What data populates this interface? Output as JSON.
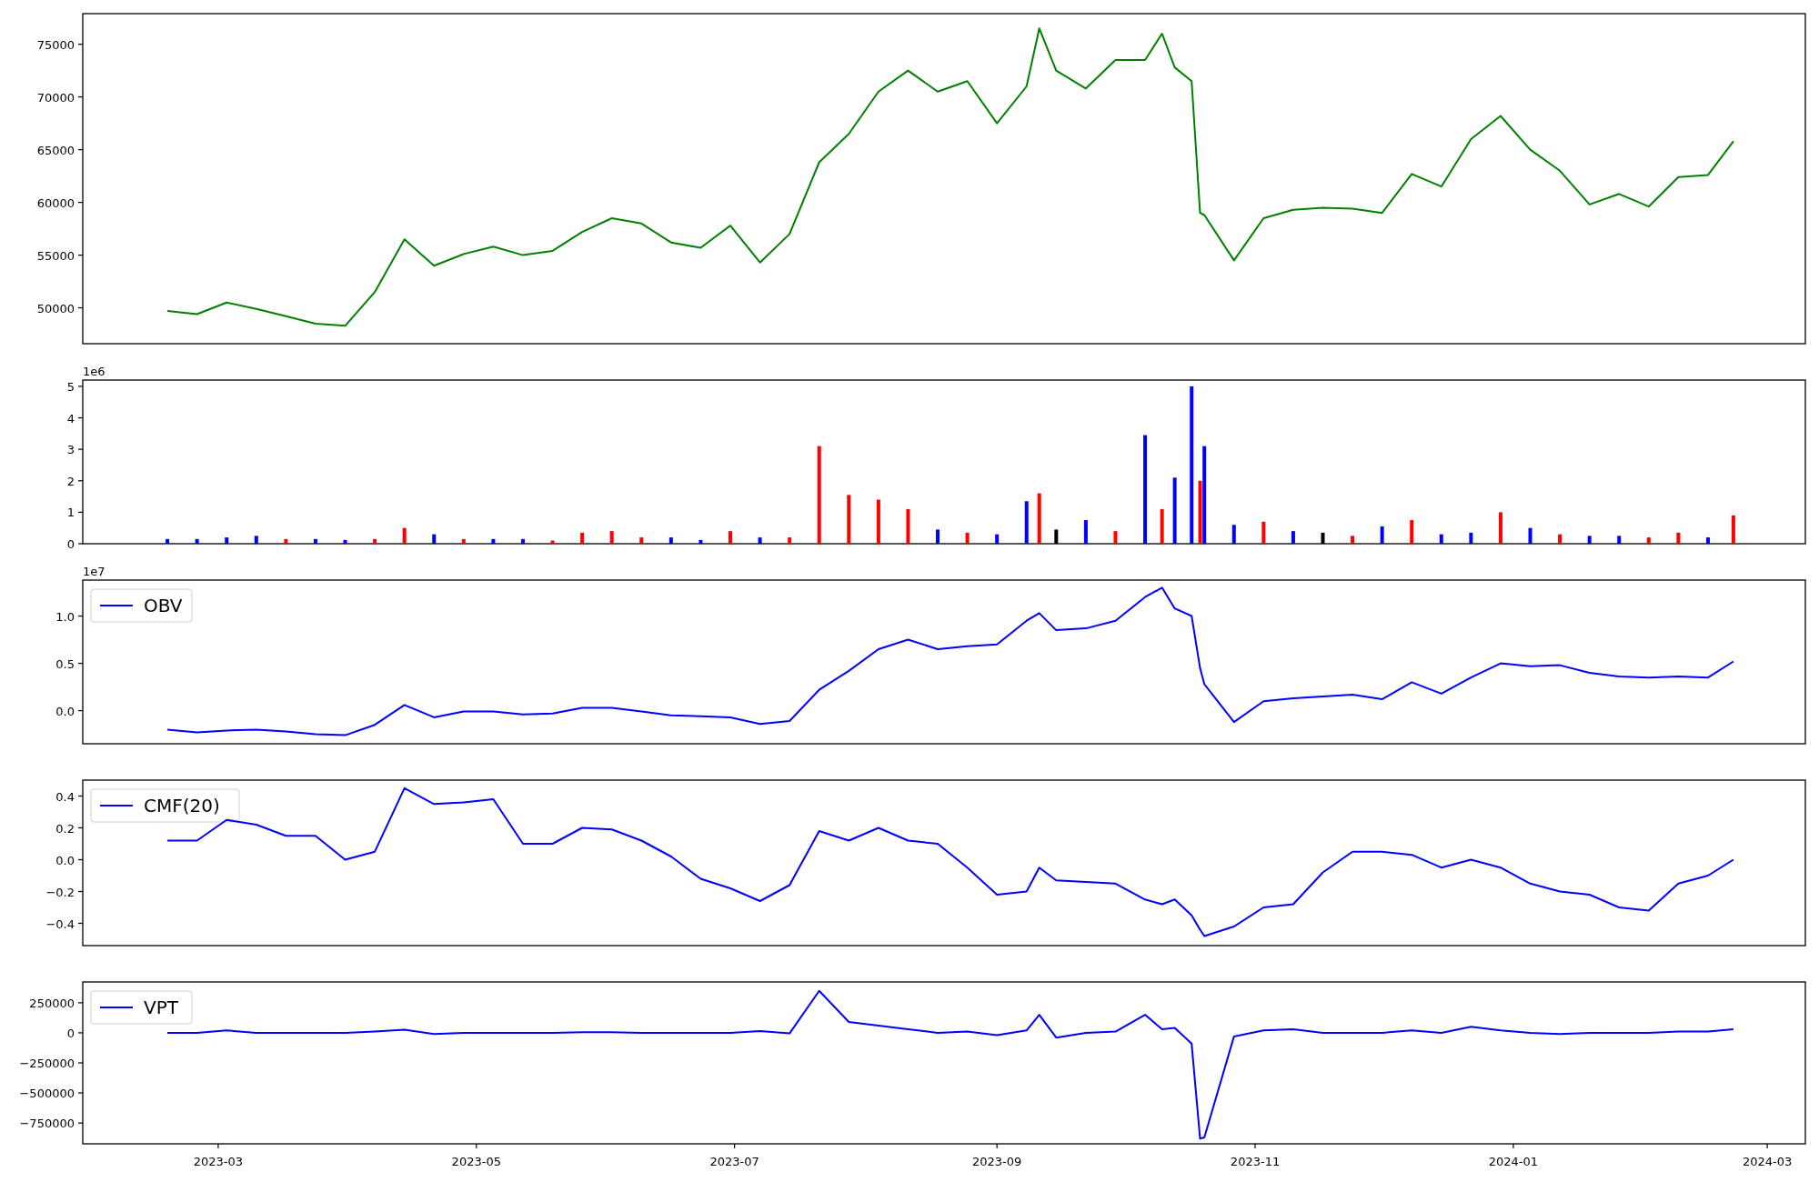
{
  "panels": [
    {
      "chart_data": {
        "type": "line",
        "x": [
          "2023-02-17",
          "2023-02-24",
          "2023-03-03",
          "2023-03-10",
          "2023-03-17",
          "2023-03-24",
          "2023-03-31",
          "2023-04-07",
          "2023-04-14",
          "2023-04-21",
          "2023-04-28",
          "2023-05-05",
          "2023-05-12",
          "2023-05-19",
          "2023-05-26",
          "2023-06-02",
          "2023-06-09",
          "2023-06-16",
          "2023-06-23",
          "2023-06-30",
          "2023-07-07",
          "2023-07-14",
          "2023-07-21",
          "2023-07-28",
          "2023-08-04",
          "2023-08-11",
          "2023-08-18",
          "2023-08-25",
          "2023-09-01",
          "2023-09-08",
          "2023-09-11",
          "2023-09-15",
          "2023-09-22",
          "2023-09-29",
          "2023-10-06",
          "2023-10-10",
          "2023-10-13",
          "2023-10-17",
          "2023-10-19",
          "2023-10-20",
          "2023-10-27",
          "2023-11-03",
          "2023-11-10",
          "2023-11-17",
          "2023-11-24",
          "2023-12-01",
          "2023-12-08",
          "2023-12-15",
          "2023-12-22",
          "2023-12-29",
          "2024-01-05",
          "2024-01-12",
          "2024-01-19",
          "2024-01-26",
          "2024-02-02",
          "2024-02-09",
          "2024-02-16",
          "2024-02-22"
        ],
        "series": [
          {
            "color": "#008000",
            "values": [
              49700,
              49400,
              50500,
              49900,
              49200,
              48500,
              48300,
              51500,
              56500,
              54000,
              55100,
              55800,
              55000,
              55400,
              57200,
              58500,
              58000,
              56200,
              55700,
              57800,
              54300,
              57000,
              63800,
              66500,
              70500,
              72500,
              70500,
              71500,
              67500,
              71000,
              76500,
              72500,
              70800,
              73500,
              73500,
              76000,
              72800,
              71500,
              59000,
              58800,
              54500,
              58500,
              59300,
              59500,
              59400,
              59000,
              62700,
              61500,
              66000,
              68200,
              65000,
              63000,
              59800,
              60800,
              59600,
              62400,
              62600,
              65800
            ]
          }
        ],
        "xlim": [
          "2023-01-28",
          "2024-03-10"
        ],
        "ylim": [
          46600,
          77900
        ],
        "yticks": [
          50000,
          55000,
          60000,
          65000,
          70000,
          75000
        ]
      }
    },
    {
      "offset_label": "1e6",
      "chart_data": {
        "type": "bar",
        "x": [
          "2023-02-17",
          "2023-02-24",
          "2023-03-03",
          "2023-03-10",
          "2023-03-17",
          "2023-03-24",
          "2023-03-31",
          "2023-04-07",
          "2023-04-14",
          "2023-04-21",
          "2023-04-28",
          "2023-05-05",
          "2023-05-12",
          "2023-05-19",
          "2023-05-26",
          "2023-06-02",
          "2023-06-09",
          "2023-06-16",
          "2023-06-23",
          "2023-06-30",
          "2023-07-07",
          "2023-07-14",
          "2023-07-21",
          "2023-07-28",
          "2023-08-04",
          "2023-08-11",
          "2023-08-18",
          "2023-08-25",
          "2023-09-01",
          "2023-09-08",
          "2023-09-11",
          "2023-09-15",
          "2023-09-22",
          "2023-09-29",
          "2023-10-06",
          "2023-10-10",
          "2023-10-13",
          "2023-10-17",
          "2023-10-19",
          "2023-10-20",
          "2023-10-27",
          "2023-11-03",
          "2023-11-10",
          "2023-11-17",
          "2023-11-24",
          "2023-12-01",
          "2023-12-08",
          "2023-12-15",
          "2023-12-22",
          "2023-12-29",
          "2024-01-05",
          "2024-01-12",
          "2024-01-19",
          "2024-01-26",
          "2024-02-02",
          "2024-02-09",
          "2024-02-16",
          "2024-02-22"
        ],
        "series": [
          {
            "color": "#ff0000",
            "values": [
              null,
              null,
              null,
              null,
              0.15,
              null,
              null,
              0.15,
              0.5,
              null,
              0.15,
              null,
              null,
              0.1,
              0.35,
              0.4,
              0.2,
              null,
              null,
              0.4,
              null,
              0.2,
              3.1,
              1.55,
              1.4,
              1.1,
              null,
              0.35,
              null,
              null,
              1.6,
              null,
              null,
              0.4,
              null,
              1.1,
              null,
              null,
              2.0,
              null,
              null,
              0.7,
              null,
              null,
              0.25,
              null,
              0.75,
              null,
              null,
              1.0,
              null,
              0.3,
              null,
              null,
              0.2,
              0.35,
              null,
              0.9
            ]
          },
          {
            "color": "#0000ff",
            "values": [
              0.15,
              0.15,
              0.2,
              0.25,
              null,
              0.15,
              0.12,
              null,
              null,
              0.3,
              null,
              0.15,
              0.15,
              null,
              null,
              null,
              null,
              0.2,
              0.12,
              null,
              0.2,
              null,
              null,
              null,
              null,
              null,
              0.45,
              null,
              0.3,
              1.35,
              null,
              null,
              0.75,
              null,
              3.45,
              null,
              2.1,
              5.0,
              null,
              3.1,
              0.6,
              null,
              0.4,
              null,
              null,
              0.55,
              null,
              0.3,
              0.35,
              null,
              0.5,
              null,
              0.25,
              0.25,
              null,
              null,
              0.2,
              null
            ]
          },
          {
            "color": "#000000",
            "values": [
              null,
              null,
              null,
              null,
              null,
              null,
              null,
              null,
              null,
              null,
              null,
              null,
              null,
              null,
              null,
              null,
              null,
              null,
              null,
              null,
              null,
              null,
              null,
              null,
              null,
              null,
              null,
              null,
              null,
              null,
              null,
              0.45,
              null,
              null,
              null,
              null,
              null,
              null,
              null,
              null,
              null,
              null,
              null,
              0.35,
              null,
              null,
              null,
              null,
              null,
              null,
              null,
              null,
              null,
              null,
              null,
              null,
              null,
              null
            ]
          }
        ],
        "xlim": [
          "2023-01-28",
          "2024-03-10"
        ],
        "ylim": [
          0,
          5.2
        ],
        "yticks": [
          0,
          1,
          2,
          3,
          4,
          5
        ]
      }
    },
    {
      "offset_label": "1e7",
      "chart_data": {
        "type": "line",
        "x": [
          "2023-02-17",
          "2023-02-24",
          "2023-03-03",
          "2023-03-10",
          "2023-03-17",
          "2023-03-24",
          "2023-03-31",
          "2023-04-07",
          "2023-04-14",
          "2023-04-21",
          "2023-04-28",
          "2023-05-05",
          "2023-05-12",
          "2023-05-19",
          "2023-05-26",
          "2023-06-02",
          "2023-06-09",
          "2023-06-16",
          "2023-06-23",
          "2023-06-30",
          "2023-07-07",
          "2023-07-14",
          "2023-07-21",
          "2023-07-28",
          "2023-08-04",
          "2023-08-11",
          "2023-08-18",
          "2023-08-25",
          "2023-09-01",
          "2023-09-08",
          "2023-09-11",
          "2023-09-15",
          "2023-09-22",
          "2023-09-29",
          "2023-10-06",
          "2023-10-10",
          "2023-10-13",
          "2023-10-17",
          "2023-10-19",
          "2023-10-20",
          "2023-10-27",
          "2023-11-03",
          "2023-11-10",
          "2023-11-17",
          "2023-11-24",
          "2023-12-01",
          "2023-12-08",
          "2023-12-15",
          "2023-12-22",
          "2023-12-29",
          "2024-01-05",
          "2024-01-12",
          "2024-01-19",
          "2024-01-26",
          "2024-02-02",
          "2024-02-09",
          "2024-02-16",
          "2024-02-22"
        ],
        "series": [
          {
            "name": "OBV",
            "color": "#0000ff",
            "values": [
              -0.2,
              -0.23,
              -0.21,
              -0.2,
              -0.22,
              -0.25,
              -0.26,
              -0.15,
              0.06,
              -0.07,
              -0.01,
              -0.01,
              -0.04,
              -0.03,
              0.03,
              0.03,
              -0.01,
              -0.05,
              -0.06,
              -0.07,
              -0.14,
              -0.11,
              0.22,
              0.42,
              0.65,
              0.75,
              0.65,
              0.68,
              0.7,
              0.95,
              1.03,
              0.85,
              0.87,
              0.95,
              1.2,
              1.3,
              1.08,
              1.0,
              0.45,
              0.28,
              -0.12,
              0.1,
              0.13,
              0.15,
              0.17,
              0.12,
              0.3,
              0.18,
              0.35,
              0.5,
              0.47,
              0.48,
              0.4,
              0.36,
              0.35,
              0.36,
              0.35,
              0.52
            ]
          }
        ],
        "xlim": [
          "2023-01-28",
          "2024-03-10"
        ],
        "ylim": [
          -0.35,
          1.38
        ],
        "yticks": [
          {
            "value": 0,
            "label": "0.0"
          },
          {
            "value": 0.5,
            "label": "0.5"
          },
          {
            "value": 1,
            "label": "1.0"
          }
        ]
      }
    },
    {
      "chart_data": {
        "type": "line",
        "x": [
          "2023-02-17",
          "2023-02-24",
          "2023-03-03",
          "2023-03-10",
          "2023-03-17",
          "2023-03-24",
          "2023-03-31",
          "2023-04-07",
          "2023-04-14",
          "2023-04-21",
          "2023-04-28",
          "2023-05-05",
          "2023-05-12",
          "2023-05-19",
          "2023-05-26",
          "2023-06-02",
          "2023-06-09",
          "2023-06-16",
          "2023-06-23",
          "2023-06-30",
          "2023-07-07",
          "2023-07-14",
          "2023-07-21",
          "2023-07-28",
          "2023-08-04",
          "2023-08-11",
          "2023-08-18",
          "2023-08-25",
          "2023-09-01",
          "2023-09-08",
          "2023-09-11",
          "2023-09-15",
          "2023-09-22",
          "2023-09-29",
          "2023-10-06",
          "2023-10-10",
          "2023-10-13",
          "2023-10-17",
          "2023-10-19",
          "2023-10-20",
          "2023-10-27",
          "2023-11-03",
          "2023-11-10",
          "2023-11-17",
          "2023-11-24",
          "2023-12-01",
          "2023-12-08",
          "2023-12-15",
          "2023-12-22",
          "2023-12-29",
          "2024-01-05",
          "2024-01-12",
          "2024-01-19",
          "2024-01-26",
          "2024-02-02",
          "2024-02-09",
          "2024-02-16",
          "2024-02-22"
        ],
        "series": [
          {
            "name": "CMF(20)",
            "color": "#0000ff",
            "values": [
              0.12,
              0.12,
              0.25,
              0.22,
              0.15,
              0.15,
              0.0,
              0.05,
              0.45,
              0.35,
              0.36,
              0.38,
              0.1,
              0.1,
              0.2,
              0.19,
              0.12,
              0.02,
              -0.12,
              -0.18,
              -0.26,
              -0.16,
              0.18,
              0.12,
              0.2,
              0.12,
              0.1,
              -0.05,
              -0.22,
              -0.2,
              -0.05,
              -0.13,
              -0.14,
              -0.15,
              -0.25,
              -0.28,
              -0.25,
              -0.35,
              -0.44,
              -0.48,
              -0.42,
              -0.3,
              -0.28,
              -0.08,
              0.05,
              0.05,
              0.03,
              -0.05,
              0.0,
              -0.05,
              -0.15,
              -0.2,
              -0.22,
              -0.3,
              -0.32,
              -0.15,
              -0.1,
              0.0
            ]
          }
        ],
        "xlim": [
          "2023-01-28",
          "2024-03-10"
        ],
        "ylim": [
          -0.54,
          0.5
        ],
        "yticks": [
          {
            "value": -0.4,
            "label": "−0.4"
          },
          {
            "value": -0.2,
            "label": "−0.2"
          },
          {
            "value": 0,
            "label": "0.0"
          },
          {
            "value": 0.2,
            "label": "0.2"
          },
          {
            "value": 0.4,
            "label": "0.4"
          }
        ]
      }
    },
    {
      "chart_data": {
        "type": "line",
        "x": [
          "2023-02-17",
          "2023-02-24",
          "2023-03-03",
          "2023-03-10",
          "2023-03-17",
          "2023-03-24",
          "2023-03-31",
          "2023-04-07",
          "2023-04-14",
          "2023-04-21",
          "2023-04-28",
          "2023-05-05",
          "2023-05-12",
          "2023-05-19",
          "2023-05-26",
          "2023-06-02",
          "2023-06-09",
          "2023-06-16",
          "2023-06-23",
          "2023-06-30",
          "2023-07-07",
          "2023-07-14",
          "2023-07-21",
          "2023-07-28",
          "2023-08-04",
          "2023-08-11",
          "2023-08-18",
          "2023-08-25",
          "2023-09-01",
          "2023-09-08",
          "2023-09-11",
          "2023-09-15",
          "2023-09-22",
          "2023-09-29",
          "2023-10-06",
          "2023-10-10",
          "2023-10-13",
          "2023-10-17",
          "2023-10-19",
          "2023-10-20",
          "2023-10-27",
          "2023-11-03",
          "2023-11-10",
          "2023-11-17",
          "2023-11-24",
          "2023-12-01",
          "2023-12-08",
          "2023-12-15",
          "2023-12-22",
          "2023-12-29",
          "2024-01-05",
          "2024-01-12",
          "2024-01-19",
          "2024-01-26",
          "2024-02-02",
          "2024-02-09",
          "2024-02-16",
          "2024-02-22"
        ],
        "series": [
          {
            "name": "VPT",
            "color": "#0000ff",
            "values": [
              0,
              0,
              20000,
              0,
              0,
              0,
              0,
              10000,
              25000,
              -10000,
              0,
              0,
              0,
              0,
              5000,
              5000,
              0,
              0,
              0,
              0,
              15000,
              -5000,
              350000,
              90000,
              60000,
              30000,
              0,
              10000,
              -20000,
              20000,
              150000,
              -40000,
              0,
              10000,
              150000,
              30000,
              40000,
              -90000,
              -880000,
              -870000,
              -30000,
              20000,
              30000,
              0,
              0,
              0,
              20000,
              0,
              50000,
              20000,
              0,
              -10000,
              0,
              0,
              0,
              10000,
              10000,
              30000
            ]
          }
        ],
        "xlim": [
          "2023-01-28",
          "2024-03-10"
        ],
        "ylim": [
          -923000,
          423000
        ],
        "yticks": [
          {
            "value": -750000,
            "label": "−750000"
          },
          {
            "value": -500000,
            "label": "−500000"
          },
          {
            "value": -250000,
            "label": "−250000"
          },
          {
            "value": 0,
            "label": "0"
          },
          {
            "value": 250000,
            "label": "250000"
          }
        ],
        "xticks": [
          {
            "value": "2023-03-01",
            "label": "2023-03"
          },
          {
            "value": "2023-05-01",
            "label": "2023-05"
          },
          {
            "value": "2023-07-01",
            "label": "2023-07"
          },
          {
            "value": "2023-09-01",
            "label": "2023-09"
          },
          {
            "value": "2023-11-01",
            "label": "2023-11"
          },
          {
            "value": "2024-01-01",
            "label": "2024-01"
          },
          {
            "value": "2024-03-01",
            "label": "2024-03"
          }
        ]
      }
    }
  ]
}
